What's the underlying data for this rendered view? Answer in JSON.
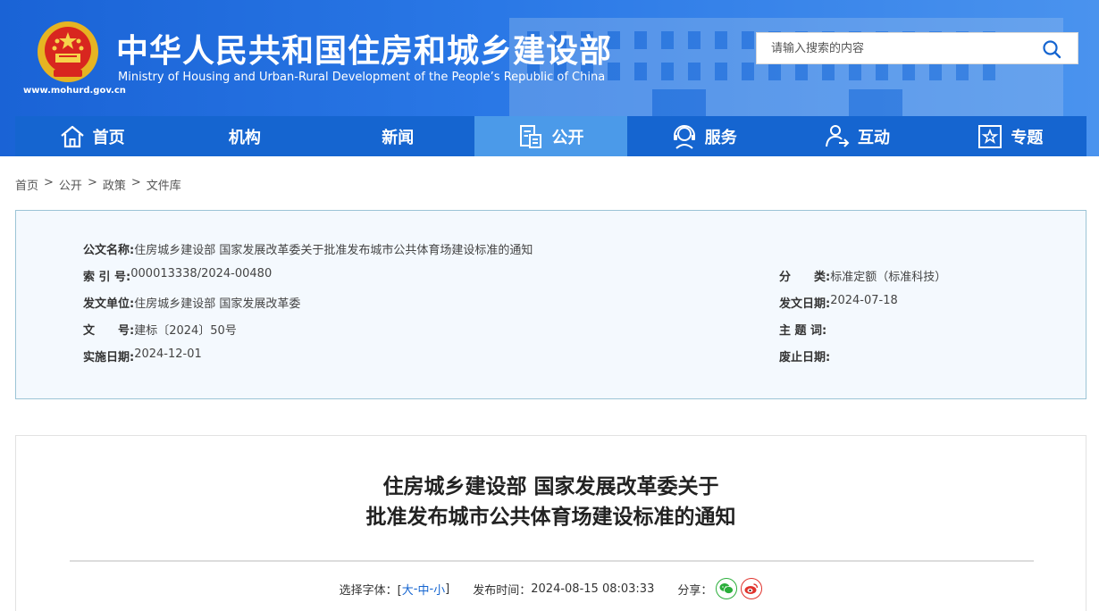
{
  "header": {
    "title_cn": "中华人民共和国住房和城乡建设部",
    "title_en": "Ministry of Housing and Urban-Rural Development of the People’s Republic of China",
    "site_url": "www.mohurd.gov.cn",
    "search_placeholder": "请输入搜索的内容"
  },
  "nav": {
    "items": [
      {
        "label": "首页",
        "icon": "home-icon"
      },
      {
        "label": "机构",
        "icon": ""
      },
      {
        "label": "新闻",
        "icon": ""
      },
      {
        "label": "公开",
        "icon": "document-icon",
        "active": true
      },
      {
        "label": "服务",
        "icon": "service-icon"
      },
      {
        "label": "互动",
        "icon": "interact-icon"
      },
      {
        "label": "专题",
        "icon": "star-icon"
      }
    ]
  },
  "breadcrumb": [
    "首页",
    "公开",
    "政策",
    "文件库"
  ],
  "breadcrumb_sep": ">",
  "info": {
    "name_label": "公文名称:",
    "name_value": "住房城乡建设部 国家发展改革委关于批准发布城市公共体育场建设标准的通知",
    "index_label": "索 引 号:",
    "index_value": "000013338/2024-00480",
    "category_label": "分　　类:",
    "category_value": "标准定额（标准科技）",
    "issuer_label": "发文单位:",
    "issuer_value": "住房城乡建设部 国家发展改革委",
    "date_label": "发文日期:",
    "date_value": "2024-07-18",
    "docno_label": "文　　号:",
    "docno_value": "建标〔2024〕50号",
    "keywords_label": "主 题 词:",
    "keywords_value": "",
    "effective_label": "实施日期:",
    "effective_value": "2024-12-01",
    "expire_label": "废止日期:",
    "expire_value": ""
  },
  "article": {
    "title_line1": "住房城乡建设部 国家发展改革委关于",
    "title_line2": "批准发布城市公共体育场建设标准的通知",
    "font_label": "选择字体：[",
    "font_large": "大",
    "font_medium": "中",
    "font_small": "小",
    "font_sep": "-",
    "font_close": "]",
    "publish_label": "发布时间：",
    "publish_time": "2024-08-15 08:03:33",
    "share_label": "分享："
  },
  "colors": {
    "nav_bg": "#1565d0",
    "nav_active": "#4b9ae9",
    "wechat": "#2aae3a",
    "weibo": "#e0322c"
  }
}
